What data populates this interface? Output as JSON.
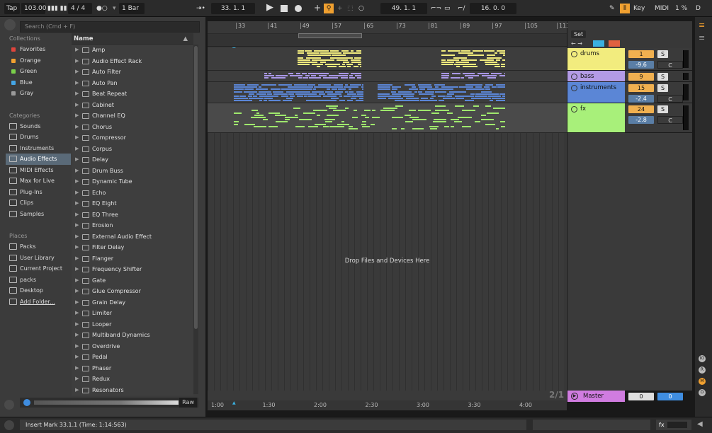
{
  "transport": {
    "tap": "Tap",
    "tempo": "103.00",
    "meter_icon": "metronome-bars-icon",
    "signature": "4 / 4",
    "follow": "●○",
    "quantize": "1 Bar",
    "position": "33.  1.  1",
    "punch_pos": "49.  1.  1",
    "loop_len": "16.  0.  0",
    "key_label": "Key",
    "midi_label": "MIDI",
    "cpu": "1 %",
    "d_label": "D"
  },
  "browser": {
    "search_placeholder": "Search (Cmd + F)",
    "collections_title": "Collections",
    "collections": [
      {
        "label": "Favorites",
        "color": "#e0443c"
      },
      {
        "label": "Orange",
        "color": "#f0a030"
      },
      {
        "label": "Green",
        "color": "#7ad04a"
      },
      {
        "label": "Blue",
        "color": "#45a6e6"
      },
      {
        "label": "Gray",
        "color": "#9a9a9a"
      }
    ],
    "categories_title": "Categories",
    "categories": [
      "Sounds",
      "Drums",
      "Instruments",
      "Audio Effects",
      "MIDI Effects",
      "Max for Live",
      "Plug-Ins",
      "Clips",
      "Samples"
    ],
    "places_title": "Places",
    "places": [
      "Packs",
      "User Library",
      "Current Project",
      "packs",
      "Desktop",
      "Add Folder..."
    ],
    "name_header": "Name",
    "items": [
      "Amp",
      "Audio Effect Rack",
      "Auto Filter",
      "Auto Pan",
      "Beat Repeat",
      "Cabinet",
      "Channel EQ",
      "Chorus",
      "Compressor",
      "Corpus",
      "Delay",
      "Drum Buss",
      "Dynamic Tube",
      "Echo",
      "EQ Eight",
      "EQ Three",
      "Erosion",
      "External Audio Effect",
      "Filter Delay",
      "Flanger",
      "Frequency Shifter",
      "Gate",
      "Glue Compressor",
      "Grain Delay",
      "Limiter",
      "Looper",
      "Multiband Dynamics",
      "Overdrive",
      "Pedal",
      "Phaser",
      "Redux",
      "Resonators"
    ],
    "raw_label": "Raw"
  },
  "arrangement": {
    "bar_ticks": [
      "33",
      "41",
      "49",
      "57",
      "65",
      "73",
      "81",
      "89",
      "97",
      "105",
      "113"
    ],
    "time_ticks": [
      "1:00",
      "1:30",
      "2:00",
      "2:30",
      "3:00",
      "3:30",
      "4:00"
    ],
    "drop_text": "Drop Files and Devices Here",
    "set_label": "Set",
    "page_indicator": "2/1"
  },
  "tracks": [
    {
      "name": "drums",
      "color": "#f2ec7e",
      "number": "1",
      "volume": "-9.6",
      "pan": "C",
      "clip_color": "#f2ec7e"
    },
    {
      "name": "bass",
      "color": "#b39be6",
      "number": "9",
      "volume": "",
      "pan": "",
      "clip_color": "#a997e6"
    },
    {
      "name": "instruments",
      "color": "#5b86d6",
      "number": "15",
      "volume": "-2.4",
      "pan": "C",
      "clip_color": "#5b86d6"
    },
    {
      "name": "fx",
      "color": "#a8f07a",
      "number": "24",
      "volume": "-2.8",
      "pan": "C",
      "clip_color": "#9fe86d"
    }
  ],
  "master": {
    "name": "Master",
    "color": "#d07ce0",
    "value": "0",
    "value2": "0"
  },
  "status": {
    "message": "Insert Mark 33.1.1 (Time: 1:14:563)",
    "fx_label": "fx"
  }
}
